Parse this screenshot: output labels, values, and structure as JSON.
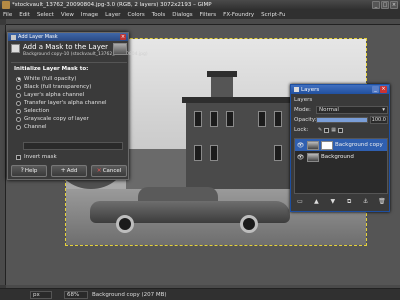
{
  "window": {
    "title": "*stockvault_13762_20090804.jpg-3.0 (RGB, 2 layers) 3072x2193 – GIMP",
    "controls": [
      "_",
      "□",
      "×"
    ]
  },
  "menubar": [
    "File",
    "Edit",
    "Select",
    "View",
    "Image",
    "Layer",
    "Colors",
    "Tools",
    "Dialogs",
    "Filters",
    "FX-Foundry",
    "Script-Fu"
  ],
  "mask_dialog": {
    "title": "Add Layer Mask",
    "header": "Add a Mask to the Layer",
    "subheader": "Background copy-10 (stockvault_13762_20090804.jpg)",
    "group_label": "Initialize Layer Mask to:",
    "options": [
      {
        "label": "White (full opacity)",
        "selected": true
      },
      {
        "label": "Black (full transparency)",
        "selected": false
      },
      {
        "label": "Layer's alpha channel",
        "selected": false
      },
      {
        "label": "Transfer layer's alpha channel",
        "selected": false
      },
      {
        "label": "Selection",
        "selected": false
      },
      {
        "label": "Grayscale copy of layer",
        "selected": false
      },
      {
        "label": "Channel",
        "selected": false
      }
    ],
    "invert_label": "Invert mask",
    "buttons": {
      "help": "Help",
      "add": "Add",
      "cancel": "Cancel"
    }
  },
  "layers_dock": {
    "title": "Layers",
    "heading": "Layers",
    "mode_label": "Mode:",
    "mode_value": "Normal",
    "opacity_label": "Opacity:",
    "opacity_value": "100.0",
    "opacity_fraction": 1.0,
    "lock_label": "Lock:",
    "layers": [
      {
        "name": "Background copy",
        "selected": true,
        "has_mask": true
      },
      {
        "name": "Background",
        "selected": false,
        "has_mask": false
      }
    ]
  },
  "statusbar": {
    "unit": "px",
    "zoom": "68%",
    "message": "Background copy (207 MB)"
  },
  "colors": {
    "accent": "#2f5fb0",
    "selection_outline": "#e6d23a"
  }
}
